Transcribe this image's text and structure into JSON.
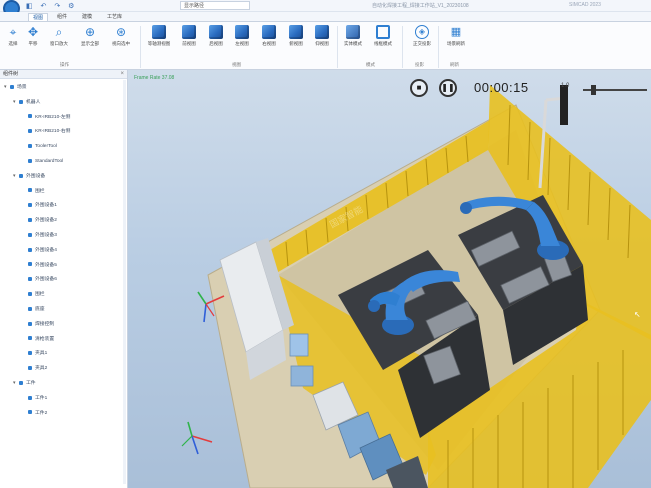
{
  "titlebar": {
    "layout_select": "显示路径",
    "title": "自动化焊接工程_焊接工作站_V1_20230108",
    "brand": "SIMCAD 2023"
  },
  "tabs": [
    {
      "label": "视图",
      "active": true
    },
    {
      "label": "组件",
      "active": false
    },
    {
      "label": "建模",
      "active": false
    },
    {
      "label": "工艺库",
      "active": false
    }
  ],
  "ribbon": {
    "buttons": [
      {
        "label": "选择",
        "icon": "select-arrow-icon"
      },
      {
        "label": "平移",
        "icon": "pan-icon"
      },
      {
        "label": "窗口放大",
        "icon": "zoom-window-icon"
      },
      {
        "label": "显示全部",
        "icon": "zoom-all-icon"
      },
      {
        "label": "视向选中",
        "icon": "view-selected-icon"
      },
      {
        "label": "等轴测视图",
        "icon": "iso-view-cube-icon"
      },
      {
        "label": "前视图",
        "icon": "front-view-cube-icon"
      },
      {
        "label": "后视图",
        "icon": "back-view-cube-icon"
      },
      {
        "label": "左视图",
        "icon": "left-view-cube-icon"
      },
      {
        "label": "右视图",
        "icon": "right-view-cube-icon"
      },
      {
        "label": "俯视图",
        "icon": "top-view-cube-icon"
      },
      {
        "label": "仰视图",
        "icon": "bottom-view-cube-icon"
      },
      {
        "label": "实体模式",
        "icon": "solid-mode-icon"
      },
      {
        "label": "线框模式",
        "icon": "wireframe-mode-icon"
      },
      {
        "label": "正交投影",
        "icon": "ortho-projection-icon"
      },
      {
        "label": "场景刷新",
        "icon": "scene-refresh-icon"
      }
    ],
    "groups": [
      "操作",
      "视图",
      "模式",
      "投影",
      "刷新"
    ]
  },
  "left_panel": {
    "title": "组件树",
    "pin": "×",
    "tree": [
      {
        "label": "场景",
        "level": 0,
        "expanded": true
      },
      {
        "label": "机器人",
        "level": 1,
        "expanded": true
      },
      {
        "label": "KR-IRB210-左侧",
        "level": 2
      },
      {
        "label": "KR-IRB210-右侧",
        "level": 2
      },
      {
        "label": "ToolerTool",
        "level": 2
      },
      {
        "label": "StandardTool",
        "level": 2
      },
      {
        "label": "外围设备",
        "level": 1,
        "expanded": true
      },
      {
        "label": "围栏",
        "level": 2
      },
      {
        "label": "外围设备1",
        "level": 2
      },
      {
        "label": "外围设备2",
        "level": 2
      },
      {
        "label": "外围设备3",
        "level": 2
      },
      {
        "label": "外围设备4",
        "level": 2
      },
      {
        "label": "外围设备5",
        "level": 2
      },
      {
        "label": "外围设备6",
        "level": 2
      },
      {
        "label": "围栏",
        "level": 2
      },
      {
        "label": "底座",
        "level": 2
      },
      {
        "label": "焊接控制",
        "level": 2
      },
      {
        "label": "清枪装置",
        "level": 2
      },
      {
        "label": "夹具1",
        "level": 2
      },
      {
        "label": "夹具2",
        "level": 2
      },
      {
        "label": "工件",
        "level": 1,
        "expanded": true
      },
      {
        "label": "工件1",
        "level": 2
      },
      {
        "label": "工件2",
        "level": 2
      }
    ]
  },
  "viewport": {
    "frame_rate": "Frame Rate 37.08",
    "timer": "00:00:15",
    "speed": "1.0",
    "watermark": "国家智能"
  },
  "colors": {
    "accent": "#2f7fd1",
    "fence": "#e8c020",
    "robot": "#3a86d8",
    "floor": "#d9cfb2",
    "viewport_bg": "#b9cde3"
  }
}
